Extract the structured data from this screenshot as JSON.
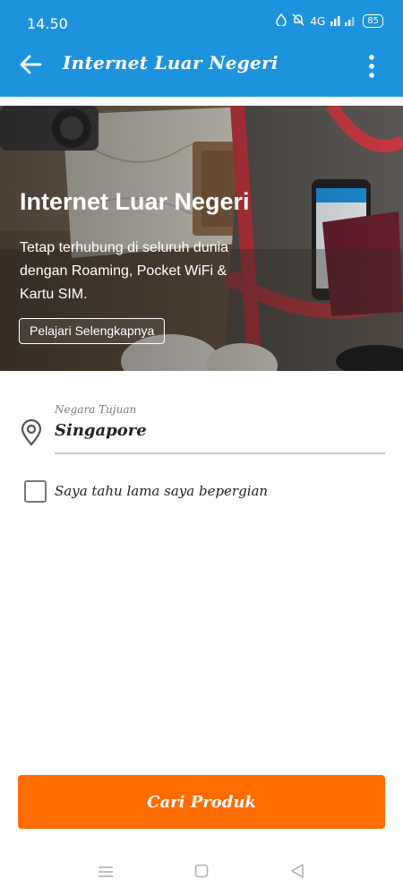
{
  "status_bar": {
    "time": "14.50",
    "network": "4G",
    "battery": "85",
    "icons": [
      "water-drop-icon",
      "silent-bell-icon",
      "signal-icon",
      "battery-icon"
    ]
  },
  "app_bar": {
    "title": "Internet Luar Negeri",
    "back_icon": "arrow-left-icon",
    "menu_icon": "more-vertical-icon"
  },
  "hero": {
    "title": "Internet Luar Negeri",
    "description": "Tetap terhubung di seluruh dunia dengan Roaming, Pocket WiFi & Kartu SIM.",
    "button_label": "Pelajari Selengkapnya"
  },
  "destination": {
    "label": "Negara Tujuan",
    "value": "Singapore",
    "icon": "location-pin-icon"
  },
  "duration_checkbox": {
    "label": "Saya tahu lama saya bepergian",
    "checked": false
  },
  "search_button": {
    "label": "Cari Produk"
  },
  "colors": {
    "primary": "#1e93dd",
    "accent": "#ff6c00"
  }
}
